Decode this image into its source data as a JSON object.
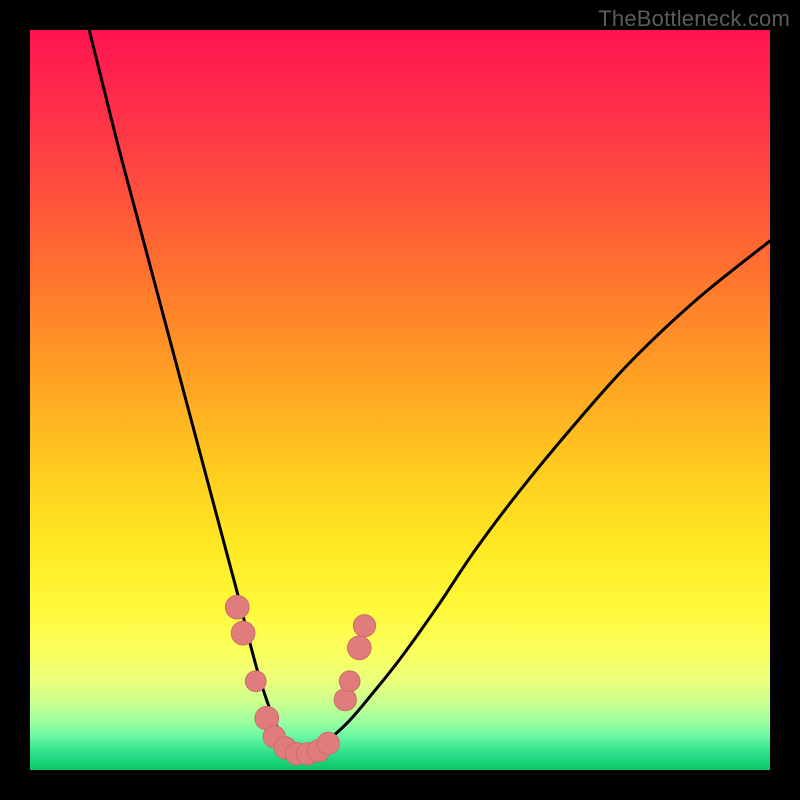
{
  "watermark": "TheBottleneck.com",
  "colors": {
    "frame_background": "#000000",
    "curve_stroke": "#000000",
    "marker_fill": "#e07c7c",
    "marker_stroke": "#cc6b6b"
  },
  "gradient_stops": [
    {
      "offset": 0.0,
      "color": "#ff1450"
    },
    {
      "offset": 0.1,
      "color": "#ff2d4a"
    },
    {
      "offset": 0.2,
      "color": "#ff4a3f"
    },
    {
      "offset": 0.3,
      "color": "#ff6a32"
    },
    {
      "offset": 0.4,
      "color": "#ff8a28"
    },
    {
      "offset": 0.5,
      "color": "#ffab22"
    },
    {
      "offset": 0.6,
      "color": "#ffce20"
    },
    {
      "offset": 0.7,
      "color": "#ffe923"
    },
    {
      "offset": 0.78,
      "color": "#fff93a"
    },
    {
      "offset": 0.84,
      "color": "#fbff5e"
    },
    {
      "offset": 0.88,
      "color": "#eaff7c"
    },
    {
      "offset": 0.91,
      "color": "#c8ff8f"
    },
    {
      "offset": 0.935,
      "color": "#9bffa0"
    },
    {
      "offset": 0.955,
      "color": "#68f7a2"
    },
    {
      "offset": 0.97,
      "color": "#3fe793"
    },
    {
      "offset": 0.985,
      "color": "#1fd77f"
    },
    {
      "offset": 1.0,
      "color": "#0bc668"
    }
  ],
  "chart_data": {
    "type": "line",
    "title": "",
    "xlabel": "",
    "ylabel": "",
    "xlim": [
      0,
      100
    ],
    "ylim": [
      0,
      100
    ],
    "note": "Background gradient maps vertical position to bottleneck severity (red ≈ high bottleneck at top, green ≈ balanced at bottom). Two black curves descend from opposite sides to a shared minimum near x≈36, y≈2. Salmon markers near the trough indicate the recommended/ideal pairing region.",
    "series": [
      {
        "name": "left-curve",
        "x": [
          8,
          10,
          12,
          14,
          16,
          18,
          20,
          22,
          24,
          26,
          28,
          29.5,
          31,
          32.5,
          34,
          35.5,
          36.2
        ],
        "y": [
          100,
          92,
          84,
          76.5,
          69,
          61.5,
          54,
          46.5,
          39,
          31.5,
          24,
          18,
          12.5,
          8,
          4.5,
          2.5,
          2
        ]
      },
      {
        "name": "right-curve",
        "x": [
          36.2,
          38,
          40,
          43,
          46,
          50,
          55,
          60,
          66,
          73,
          81,
          90,
          100
        ],
        "y": [
          2,
          2.5,
          3.8,
          6.5,
          10,
          15,
          22,
          29.5,
          37.5,
          46,
          55,
          63.5,
          71.5
        ]
      }
    ],
    "markers": [
      {
        "x": 28.0,
        "y": 22.0,
        "r": 1.6
      },
      {
        "x": 28.8,
        "y": 18.5,
        "r": 1.6
      },
      {
        "x": 30.5,
        "y": 12.0,
        "r": 1.4
      },
      {
        "x": 32.0,
        "y": 7.0,
        "r": 1.6
      },
      {
        "x": 33.0,
        "y": 4.5,
        "r": 1.5
      },
      {
        "x": 34.5,
        "y": 3.0,
        "r": 1.5
      },
      {
        "x": 36.0,
        "y": 2.2,
        "r": 1.5
      },
      {
        "x": 37.5,
        "y": 2.2,
        "r": 1.5
      },
      {
        "x": 39.0,
        "y": 2.6,
        "r": 1.5
      },
      {
        "x": 40.3,
        "y": 3.6,
        "r": 1.5
      },
      {
        "x": 42.6,
        "y": 9.5,
        "r": 1.5
      },
      {
        "x": 43.2,
        "y": 12.0,
        "r": 1.4
      },
      {
        "x": 44.5,
        "y": 16.5,
        "r": 1.6
      },
      {
        "x": 45.2,
        "y": 19.5,
        "r": 1.5
      }
    ]
  }
}
